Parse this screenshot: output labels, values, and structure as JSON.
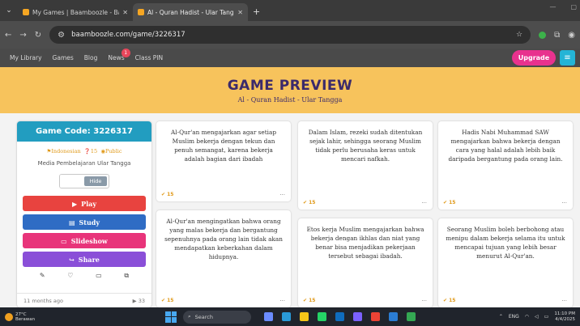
{
  "browser": {
    "tabs": [
      {
        "title": "My Games | Baamboozle - Baa",
        "active": false
      },
      {
        "title": "Al - Quran Hadist - Ular Tangga",
        "active": true
      }
    ],
    "new_tab_label": "+",
    "url": "baamboozle.com/game/3226317"
  },
  "site_nav": {
    "links": [
      "My Library",
      "Games",
      "Blog",
      "News",
      "Class PIN"
    ],
    "news_badge": "1",
    "upgrade_label": "Upgrade",
    "menu_icon": "hamburger-icon"
  },
  "banner": {
    "title": "GAME PREVIEW",
    "subtitle": "Al - Quran Hadist - Ular Tangga"
  },
  "game_panel": {
    "code": "Game Code: 3226317",
    "language": "Indonesian",
    "count": "15",
    "visibility": "Public",
    "type": "Media Pembelajaran Ular Tangga",
    "toggle_label": "Hide",
    "actions": [
      {
        "label": "Play",
        "icon": "play-icon",
        "color": "#e8433f"
      },
      {
        "label": "Study",
        "icon": "book-icon",
        "color": "#2f6cc4"
      },
      {
        "label": "Slideshow",
        "icon": "monitor-icon",
        "color": "#e8347a"
      },
      {
        "label": "Share",
        "icon": "share-icon",
        "color": "#8a4fd8"
      }
    ],
    "tool_icons": [
      "pencil-icon",
      "heart-icon",
      "folder-icon",
      "copy-icon"
    ],
    "age": "11 months ago",
    "plays": "33"
  },
  "cards": [
    {
      "text": "Al-Qur'an mengajarkan agar setiap Muslim bekerja dengan tekun dan penuh semangat, karena bekerja adalah bagian dari ibadah",
      "stat": "15"
    },
    {
      "text": "Dalam Islam, rezeki sudah ditentukan sejak lahir, sehingga seorang Muslim tidak perlu berusaha keras untuk mencari nafkah.",
      "stat": "15"
    },
    {
      "text": "Hadis Nabi Muhammad SAW mengajarkan bahwa bekerja dengan cara yang halal adalah lebih baik daripada bergantung pada orang lain.",
      "stat": "15"
    },
    {
      "text": "Al-Qur'an mengingatkan bahwa orang yang malas bekerja dan bergantung sepenuhnya pada orang lain tidak akan mendapatkan keberkahan dalam hidupnya.",
      "stat": "15"
    },
    {
      "text": "Etos kerja Muslim mengajarkan bahwa bekerja dengan ikhlas dan niat yang benar bisa menjadikan pekerjaan tersebut sebagai ibadah.",
      "stat": "15"
    },
    {
      "text": "Seorang Muslim boleh berbohong atau menipu dalam bekerja selama itu untuk mencapai tujuan yang lebih besar menurut Al-Qur'an.",
      "stat": "15"
    }
  ],
  "taskbar": {
    "temp": "27°C",
    "weather": "Berawan",
    "search_label": "Search",
    "lang": "ENG",
    "time": "11:10 PM",
    "date": "4/4/2025"
  }
}
